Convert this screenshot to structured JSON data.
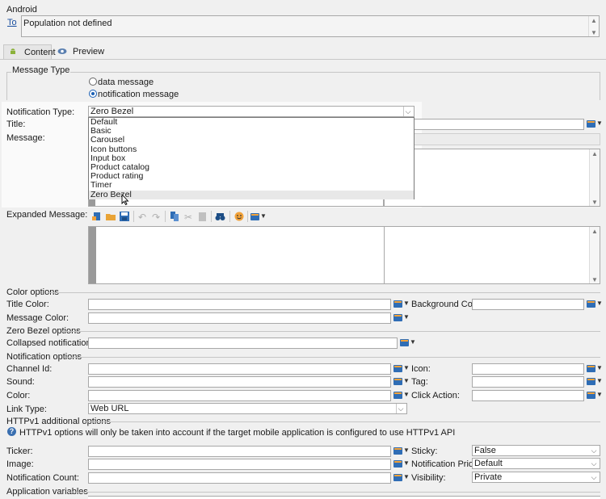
{
  "header": {
    "section_title": "Android",
    "to_link": "To",
    "to_value": "Population not defined"
  },
  "tabs": [
    {
      "label": "Content"
    },
    {
      "label": "Preview"
    }
  ],
  "message_type": {
    "legend": "Message Type",
    "options": [
      "data message",
      "notification message"
    ],
    "selected": "notification message"
  },
  "notification_type": {
    "label": "Notification Type:",
    "value": "Zero Bezel",
    "options": [
      "Default",
      "Basic",
      "Carousel",
      "Icon buttons",
      "Input box",
      "Product catalog",
      "Product rating",
      "Timer",
      "Zero Bezel"
    ]
  },
  "title_label": "Title:",
  "message_label": "Message:",
  "expanded_label": "Expanded Message:",
  "color_options": {
    "legend": "Color options",
    "title_color": "Title Color:",
    "background_color": "Background Color:",
    "message_color": "Message Color:"
  },
  "zero_bezel": {
    "legend": "Zero Bezel options",
    "collapsed_style": "Collapsed notification style:"
  },
  "notification_options": {
    "legend": "Notification options",
    "channel_id": "Channel Id:",
    "icon": "Icon:",
    "sound": "Sound:",
    "tag": "Tag:",
    "color": "Color:",
    "click_action": "Click Action:",
    "link_type_label": "Link Type:",
    "link_type_value": "Web URL"
  },
  "httpv1": {
    "legend": "HTTPv1 additional options",
    "info": "HTTPv1 options will only be taken into account if the target mobile application is configured to use HTTPv1 API",
    "ticker": "Ticker:",
    "sticky": "Sticky:",
    "sticky_value": "False",
    "image": "Image:",
    "priority": "Notification Priority:",
    "priority_value": "Default",
    "count": "Notification Count:",
    "visibility": "Visibility:",
    "visibility_value": "Private"
  },
  "app_vars": {
    "legend": "Application variables"
  },
  "colors": {
    "accent": "#2f6db5",
    "radio": "#1a5fb4",
    "link": "#1a4fa0"
  }
}
